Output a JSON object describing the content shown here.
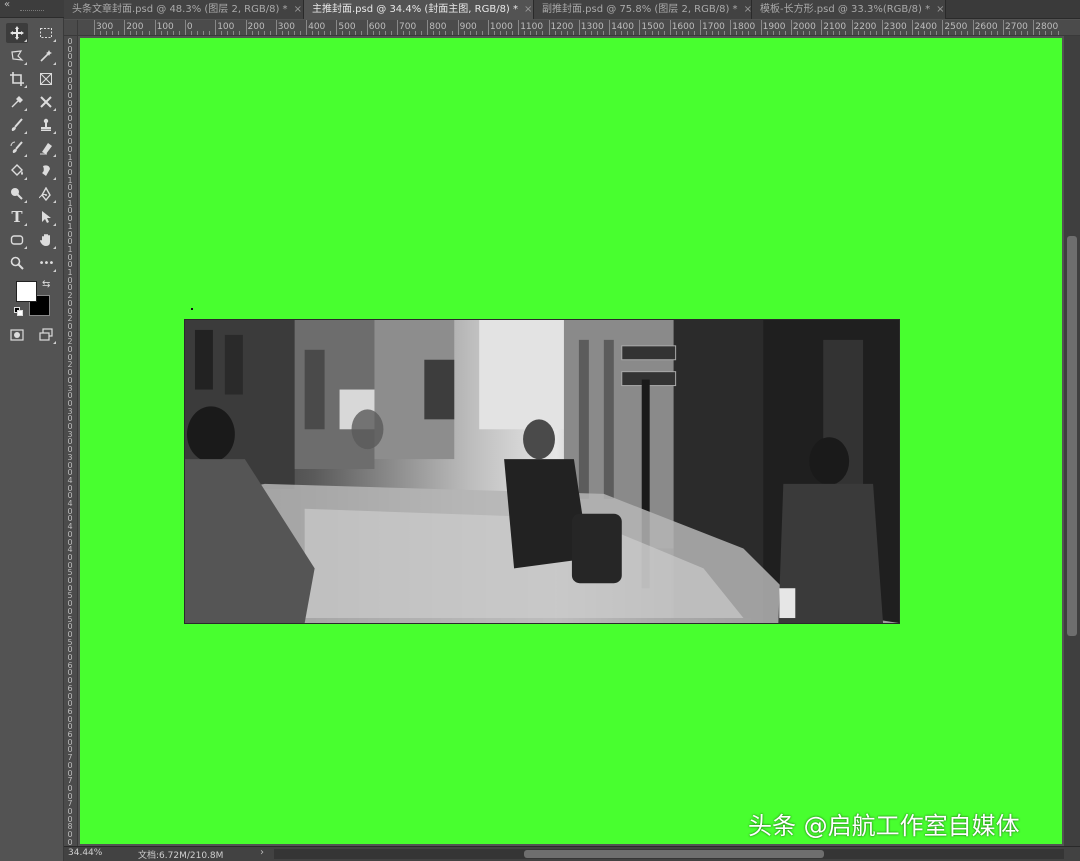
{
  "app": {
    "name": "Photoshop"
  },
  "tabs": [
    {
      "label": "头条文章封面.psd @ 48.3% (图层 2, RGB/8) *",
      "close": "×",
      "active": false
    },
    {
      "label": "主推封面.psd @ 34.4% (封面主图, RGB/8) *",
      "close": "×",
      "active": true
    },
    {
      "label": "副推封面.psd @ 75.8% (图层 2, RGB/8) *",
      "close": "×",
      "active": false
    },
    {
      "label": "模板-长方形.psd @ 33.3%(RGB/8) *",
      "close": "×",
      "active": false
    }
  ],
  "toolbar": {
    "collapse": "«",
    "tools": [
      {
        "name": "move-tool",
        "icon": "move-icon"
      },
      {
        "name": "marquee-tool",
        "icon": "rect-marquee-icon"
      },
      {
        "name": "lasso-tool",
        "icon": "polygon-lasso-icon"
      },
      {
        "name": "magic-wand-tool",
        "icon": "magic-wand-icon"
      },
      {
        "name": "crop-tool",
        "icon": "crop-icon"
      },
      {
        "name": "frame-tool",
        "icon": "frame-icon"
      },
      {
        "name": "eyedropper-tool",
        "icon": "eyedropper-icon"
      },
      {
        "name": "heal-tool",
        "icon": "healing-icon"
      },
      {
        "name": "brush-tool",
        "icon": "brush-icon"
      },
      {
        "name": "stamp-tool",
        "icon": "stamp-icon"
      },
      {
        "name": "history-brush-tool",
        "icon": "history-brush-icon"
      },
      {
        "name": "eraser-tool",
        "icon": "eraser-icon"
      },
      {
        "name": "paint-bucket-tool",
        "icon": "paint-bucket-icon"
      },
      {
        "name": "smudge-tool",
        "icon": "smudge-icon"
      },
      {
        "name": "dodge-tool",
        "icon": "dodge-icon"
      },
      {
        "name": "pen-tool",
        "icon": "pen-icon"
      },
      {
        "name": "type-tool",
        "icon": "type-icon",
        "glyph": "T"
      },
      {
        "name": "path-select-tool",
        "icon": "path-select-icon"
      },
      {
        "name": "shape-tool",
        "icon": "rounded-rect-icon"
      },
      {
        "name": "hand-tool",
        "icon": "hand-icon"
      },
      {
        "name": "zoom-tool",
        "icon": "zoom-icon"
      },
      {
        "name": "more-tools",
        "icon": "more-icon",
        "glyph": "•••"
      }
    ],
    "foreground_color": "#ffffff",
    "background_color": "#000000",
    "swap": "⇆",
    "quick_mask": "quick-mask-icon",
    "screen_mode": "screen-mode-icon"
  },
  "ruler_top": [
    "300",
    "200",
    "100",
    "0",
    "100",
    "200",
    "300",
    "400",
    "500",
    "600",
    "700",
    "800",
    "900",
    "1000",
    "1100",
    "1200",
    "1300",
    "1400",
    "1500",
    "1600",
    "1700",
    "1800",
    "1900",
    "2000",
    "2100",
    "2200",
    "2300",
    "2400",
    "2500",
    "2600",
    "2700",
    "2800"
  ],
  "ruler_left": [
    "0",
    "0",
    "0",
    "0",
    "0",
    "0",
    "0",
    "0",
    "0",
    "0",
    "0",
    "0",
    "0",
    "0",
    "0",
    "1",
    "0",
    "0",
    "1",
    "0",
    "0",
    "1",
    "0",
    "0",
    "1",
    "0",
    "0",
    "1",
    "0",
    "0",
    "1",
    "0",
    "0",
    "2",
    "0",
    "0",
    "2",
    "0",
    "0",
    "2",
    "0",
    "0",
    "2",
    "0",
    "0",
    "3",
    "0",
    "0",
    "3",
    "0",
    "0",
    "3",
    "0",
    "0",
    "3",
    "0",
    "0",
    "4",
    "0",
    "0",
    "4",
    "0",
    "0",
    "4",
    "0",
    "0",
    "4",
    "0",
    "0",
    "5",
    "0",
    "0",
    "5",
    "0",
    "0",
    "5",
    "0",
    "0",
    "5",
    "0",
    "0",
    "6",
    "0",
    "0",
    "6",
    "0",
    "0",
    "6",
    "0",
    "0",
    "6",
    "0",
    "0",
    "7",
    "0",
    "0",
    "7",
    "0",
    "0",
    "7",
    "0",
    "0",
    "8",
    "0",
    "0"
  ],
  "canvas": {
    "background_color": "#48ff2f"
  },
  "status": {
    "zoom": "34.44%",
    "doc": "文档:6.72M/210.8M",
    "arrow": "›"
  },
  "watermark": "头条 @启航工作室自媒体"
}
